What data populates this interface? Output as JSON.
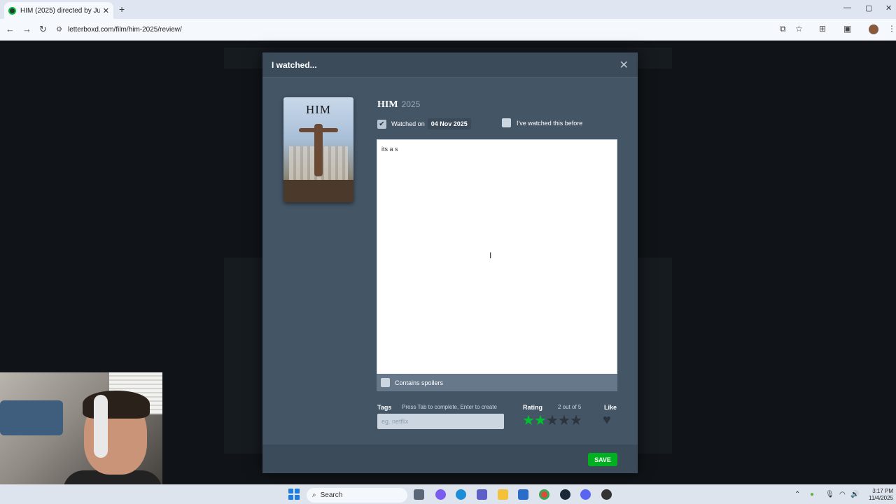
{
  "browser": {
    "tab_title": "HIM (2025) directed by Justin T",
    "tab_close": "✕",
    "new_tab": "+",
    "url": "letterboxd.com/film/him-2025/review/",
    "win_min": "—",
    "win_max": "▢",
    "win_close": "✕"
  },
  "modal": {
    "title": "I watched...",
    "close": "✕",
    "film_title": "HIM",
    "film_year": "2025",
    "poster_text": "HIM",
    "watched_on_label": "Watched on",
    "watched_date": "04 Nov 2025",
    "watched_checked": true,
    "rewatch_label": "I've watched this before",
    "rewatch_checked": false,
    "review_text": "its a s",
    "spoilers_label": "Contains spoilers",
    "tags_label": "Tags",
    "tags_hint": "Press Tab to complete, Enter to create",
    "tags_placeholder": "eg. netflix",
    "rating_label": "Rating",
    "rating_text": "2 out of 5",
    "rating_value": 2,
    "rating_max": 5,
    "like_label": "Like",
    "save_label": "SAVE",
    "colors": {
      "star_active": "#00c030",
      "star_inactive": "#2c3440",
      "save": "#00b020"
    }
  },
  "taskbar": {
    "search_label": "Search",
    "time": "3:17 PM",
    "date": "11/4/2025"
  }
}
